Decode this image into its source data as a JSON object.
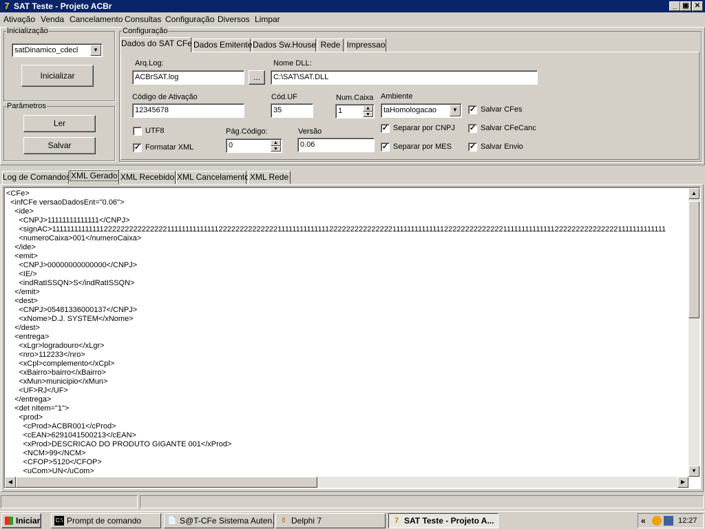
{
  "window": {
    "title": "SAT Teste - Projeto ACBr",
    "minimize": "_",
    "maximize": "▣",
    "close": "✕"
  },
  "menu": [
    "Ativação",
    "Venda",
    "Cancelamento",
    "Consultas",
    "Configuração",
    "Diversos",
    "Limpar"
  ],
  "inicializacao": {
    "group_label": "Inicialização",
    "modelo_value": "satDinamico_cdecl",
    "inicializar_label": "Inicializar"
  },
  "parametros": {
    "group_label": "Parâmetros",
    "ler_label": "Ler",
    "salvar_label": "Salvar"
  },
  "configuracao": {
    "group_label": "Configuração",
    "tabs": [
      "Dados do SAT CFe",
      "Dados Emitente",
      "Dados Sw.House",
      "Rede",
      "Impressao"
    ],
    "arq_log_label": "Arq.Log:",
    "arq_log_value": "ACBrSAT.log",
    "browse_label": "...",
    "nome_dll_label": "Nome DLL:",
    "nome_dll_value": "C:\\SAT\\SAT.DLL",
    "codigo_ativacao_label": "Código de Ativação",
    "codigo_ativacao_value": "12345678",
    "cod_uf_label": "Cód.UF",
    "cod_uf_value": "35",
    "num_caixa_label": "Num.Caixa",
    "num_caixa_value": "1",
    "ambiente_label": "Ambiente",
    "ambiente_value": "taHomologacao",
    "utf8_label": "UTF8",
    "utf8_checked": false,
    "formatar_xml_label": "Formatar XML",
    "formatar_xml_checked": true,
    "pag_codigo_label": "Pág.Código:",
    "pag_codigo_value": "0",
    "versao_label": "Versão",
    "versao_value": "0.06",
    "separar_cnpj_label": "Separar por CNPJ",
    "separar_mes_label": "Separar por MES",
    "salvar_cfes_label": "Salvar CFes",
    "salvar_cfecanc_label": "Salvar CFeCanc",
    "salvar_envio_label": "Salvar Envio",
    "check_mark": "✓"
  },
  "log_tabs": [
    "Log de Comandos",
    "XML Gerado",
    "XML Recebido",
    "XML Cancelamento",
    "XML Rede"
  ],
  "xml_lines": [
    "<CFe>",
    "  <infCFe versaoDadosEnt=\"0.06\">",
    "    <ide>",
    "      <CNPJ>11111111111111</CNPJ>",
    "      <signAC>111111111111112222222222222221111111111111122222222222222111111111111112222222222222221111111111111122222222222222111111111111112222222222222221111111111111",
    "      <numeroCaixa>001</numeroCaixa>",
    "    </ide>",
    "    <emit>",
    "      <CNPJ>00000000000000</CNPJ>",
    "      <IE/>",
    "      <indRatISSQN>S</indRatISSQN>",
    "    </emit>",
    "    <dest>",
    "      <CNPJ>05481336000137</CNPJ>",
    "      <xNome>D.J. SYSTEM</xNome>",
    "    </dest>",
    "    <entrega>",
    "      <xLgr>logradouro</xLgr>",
    "      <nro>112233</nro>",
    "      <xCpl>complemento</xCpl>",
    "      <xBairro>bairro</xBairro>",
    "      <xMun>municipio</xMun>",
    "      <UF>RJ</UF>",
    "    </entrega>",
    "    <det nItem=\"1\">",
    "      <prod>",
    "        <cProd>ACBR001</cProd>",
    "        <cEAN>6291041500213</cEAN>",
    "        <xProd>DESCRICAO DO PRODUTO GIGANTE 001</xProd>",
    "        <NCM>99</NCM>",
    "        <CFOP>5120</CFOP>",
    "        <uCom>UN</uCom>"
  ],
  "taskbar": {
    "start_label": "Iniciar",
    "tasks": [
      "Prompt de comando",
      "S@T-CFe Sistema Auten...",
      "Delphi 7",
      "SAT Teste - Projeto A..."
    ],
    "tray_arrow": "«",
    "clock": "12:27"
  },
  "colors": {
    "titlebar": "#0a246a",
    "face": "#d4d0c8",
    "window": "#ffffff"
  }
}
